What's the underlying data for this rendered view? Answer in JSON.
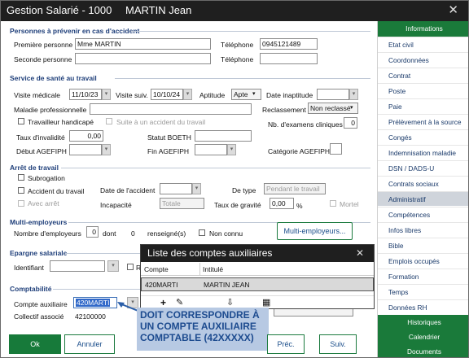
{
  "window": {
    "title_prefix": "Gestion Salarié - 1000",
    "employee_name": "MARTIN Jean",
    "close": "✕"
  },
  "accident": {
    "section": "Personnes à prévenir en cas d'accident",
    "first_label": "Première personne",
    "first_value": "Mme MARTIN",
    "phone_label": "Téléphone",
    "phone_value": "0945121489",
    "second_label": "Seconde personne",
    "phone2_label": "Téléphone"
  },
  "health": {
    "section": "Service de santé au travail",
    "visit_label": "Visite médicale",
    "visit_value": "11/10/23",
    "next_label": "Visite suiv.",
    "next_value": "10/10/24",
    "aptitude_label": "Aptitude",
    "aptitude_value": "Apte",
    "inapt_label": "Date inaptitude",
    "maladie_label": "Maladie professionnelle",
    "reclass_label": "Reclassement",
    "reclass_value": "Non reclassé",
    "handicap_label": "Travailleur handicapé",
    "suite_label": "Suite à un accident du travail",
    "exams_label": "Nb. d'examens cliniques",
    "exams_value": "0",
    "invalid_label": "Taux d'invalidité",
    "invalid_value": "0,00",
    "boeth_label": "Statut BOETH",
    "debut_label": "Début AGEFIPH",
    "fin_label": "Fin AGEFIPH",
    "categorie_label": "Catégorie AGEFIPH"
  },
  "stop": {
    "section": "Arrêt de travail",
    "subrogation": "Subrogation",
    "accident": "Accident du travail",
    "avec_arret": "Avec arrêt",
    "date_label": "Date de l'accident",
    "type_label": "De type",
    "type_value": "Pendant le travail",
    "incap_label": "Incapacité",
    "incap_value": "Totale",
    "gravite_label": "Taux de gravité",
    "gravite_value": "0,00",
    "percent": "%",
    "mortel": "Mortel"
  },
  "multi": {
    "section": "Multi-employeurs",
    "count_label": "Nombre d'employeurs",
    "count_value": "0",
    "dont": "dont",
    "dont_value": "0",
    "renseigne": "renseigné(s)",
    "non_connu": "Non connu",
    "button": "Multi-employeurs..."
  },
  "epargne": {
    "section": "Epargne salariale",
    "id_label": "Identifiant",
    "r_label": "R"
  },
  "compta": {
    "section": "Comptabilité",
    "compte_label": "Compte auxiliaire",
    "compte_value": "420MARTI",
    "collectif_label": "Collectif associé",
    "collectif_value": "42100000"
  },
  "popup": {
    "title": "Liste des comptes auxiliaires",
    "close": "✕",
    "col_compte": "Compte",
    "col_intitule": "Intitulé",
    "row_compte": "420MARTI",
    "row_intitule": "MARTIN JEAN",
    "add_icon": "+",
    "edit_icon": "✎",
    "export_icon": "⇩",
    "calc_icon": "▦"
  },
  "annotation": {
    "line1": "DOIT CORRESPONDRE À",
    "line2": "UN COMPTE AUXILIAIRE",
    "line3": "COMPTABLE (42XXXXX)"
  },
  "footer": {
    "ok": "Ok",
    "cancel": "Annuler",
    "prev": "Préc.",
    "next": "Suiv."
  },
  "sidebar": {
    "header": "Informations",
    "items": [
      "Etat civil",
      "Coordonnées",
      "Contrat",
      "Poste",
      "Paie",
      "Prélèvement à la source",
      "Congés",
      "Indemnisation maladie",
      "DSN / DADS-U",
      "Contrats sociaux",
      "Administratif",
      "Compétences",
      "Infos libres",
      "Bible",
      "Emplois occupés",
      "Formation",
      "Temps",
      "Données RH"
    ],
    "bottom": [
      "Historiques",
      "Calendrier",
      "Documents"
    ]
  },
  "colors": {
    "accent_green": "#1a7a3a",
    "section_blue": "#1f3f7a",
    "annotation_bg": "#b7c9e3"
  }
}
